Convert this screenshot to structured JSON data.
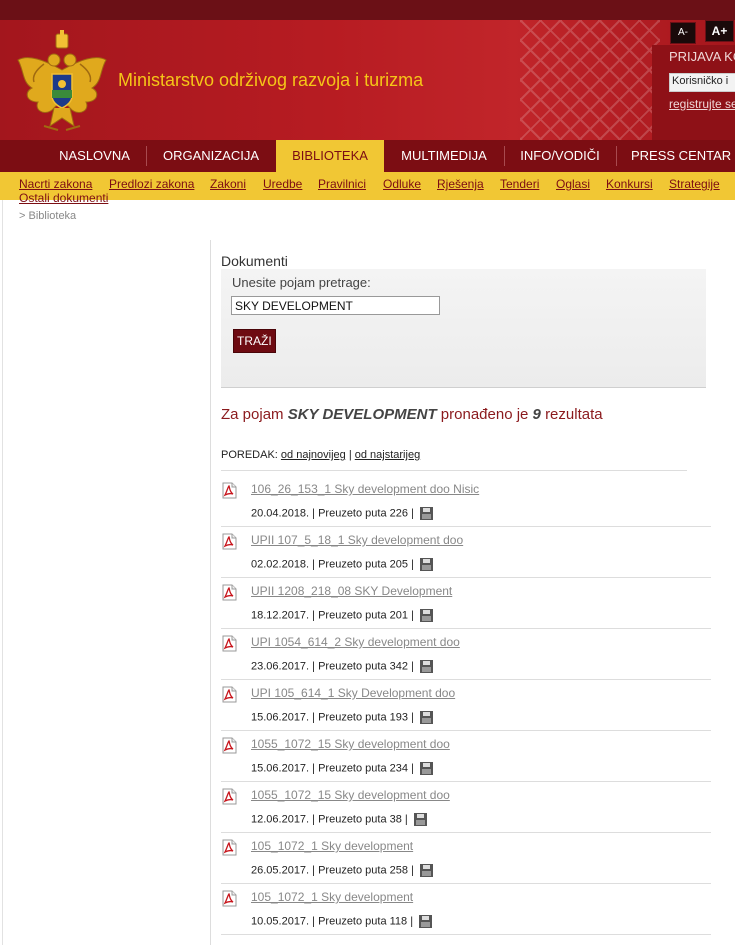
{
  "header": {
    "title": "Ministarstvo održivog razvoja i turizma",
    "font_smaller": "A-",
    "font_larger": "A+"
  },
  "login": {
    "title": "PRIJAVA KO",
    "username_value": "Korisničko i",
    "register_link": "registrujte se"
  },
  "nav": {
    "items": [
      "NASLOVNA",
      "ORGANIZACIJA",
      "BIBLIOTEKA",
      "MULTIMEDIJA",
      "INFO/VODIČI",
      "PRESS CENTAR"
    ],
    "active": "BIBLIOTEKA"
  },
  "subnav": {
    "items": [
      "Nacrti zakona",
      "Predlozi zakona",
      "Zakoni",
      "Uredbe",
      "Pravilnici",
      "Odluke",
      "Rješenja",
      "Tenderi",
      "Oglasi",
      "Konkursi",
      "Strategije",
      "Ostali dokumenti"
    ]
  },
  "breadcrumb": "> Biblioteka",
  "documents": {
    "title": "Dokumenti",
    "search_label": "Unesite pojam pretrage:",
    "search_value": "SKY DEVELOPMENT",
    "search_button": "TRAŽI"
  },
  "summary": {
    "prefix": "Za pojam",
    "term": "SKY DEVELOPMENT",
    "middle": "pronađeno je",
    "count": "9",
    "suffix": "rezultata"
  },
  "sort": {
    "label": "POREDAK:",
    "newest": "od najnovijeg",
    "separator": "|",
    "oldest": "od najstarijeg"
  },
  "results": [
    {
      "title": "106_26_153_1 Sky development doo Nisic",
      "meta": "20.04.2018. | Preuzeto puta 226 |"
    },
    {
      "title": "UPII 107_5_18_1 Sky development doo",
      "meta": "02.02.2018. | Preuzeto puta 205 |"
    },
    {
      "title": "UPII 1208_218_08 SKY Development",
      "meta": "18.12.2017. | Preuzeto puta 201 |"
    },
    {
      "title": "UPI 1054_614_2 Sky development doo",
      "meta": "23.06.2017. | Preuzeto puta 342 |"
    },
    {
      "title": "UPI 105_614_1 Sky Development doo",
      "meta": "15.06.2017. | Preuzeto puta 193 |"
    },
    {
      "title": "1055_1072_15 Sky development doo",
      "meta": "15.06.2017. | Preuzeto puta 234 |"
    },
    {
      "title": "1055_1072_15 Sky development doo",
      "meta": "12.06.2017. | Preuzeto puta 38 |"
    },
    {
      "title": "105_1072_1 Sky development",
      "meta": "26.05.2017. | Preuzeto puta 258 |"
    },
    {
      "title": "105_1072_1 Sky development",
      "meta": "10.05.2017. | Preuzeto puta 118 |"
    }
  ],
  "icons": {
    "crest": "montenegro-coat-of-arms-icon",
    "pdf": "pdf-file-icon",
    "download": "floppy-disk-icon"
  },
  "colors": {
    "brand_red": "#a3161d",
    "nav_dark": "#7c0d13",
    "accent_gold": "#f1c734",
    "title_gold": "#f5c518"
  }
}
